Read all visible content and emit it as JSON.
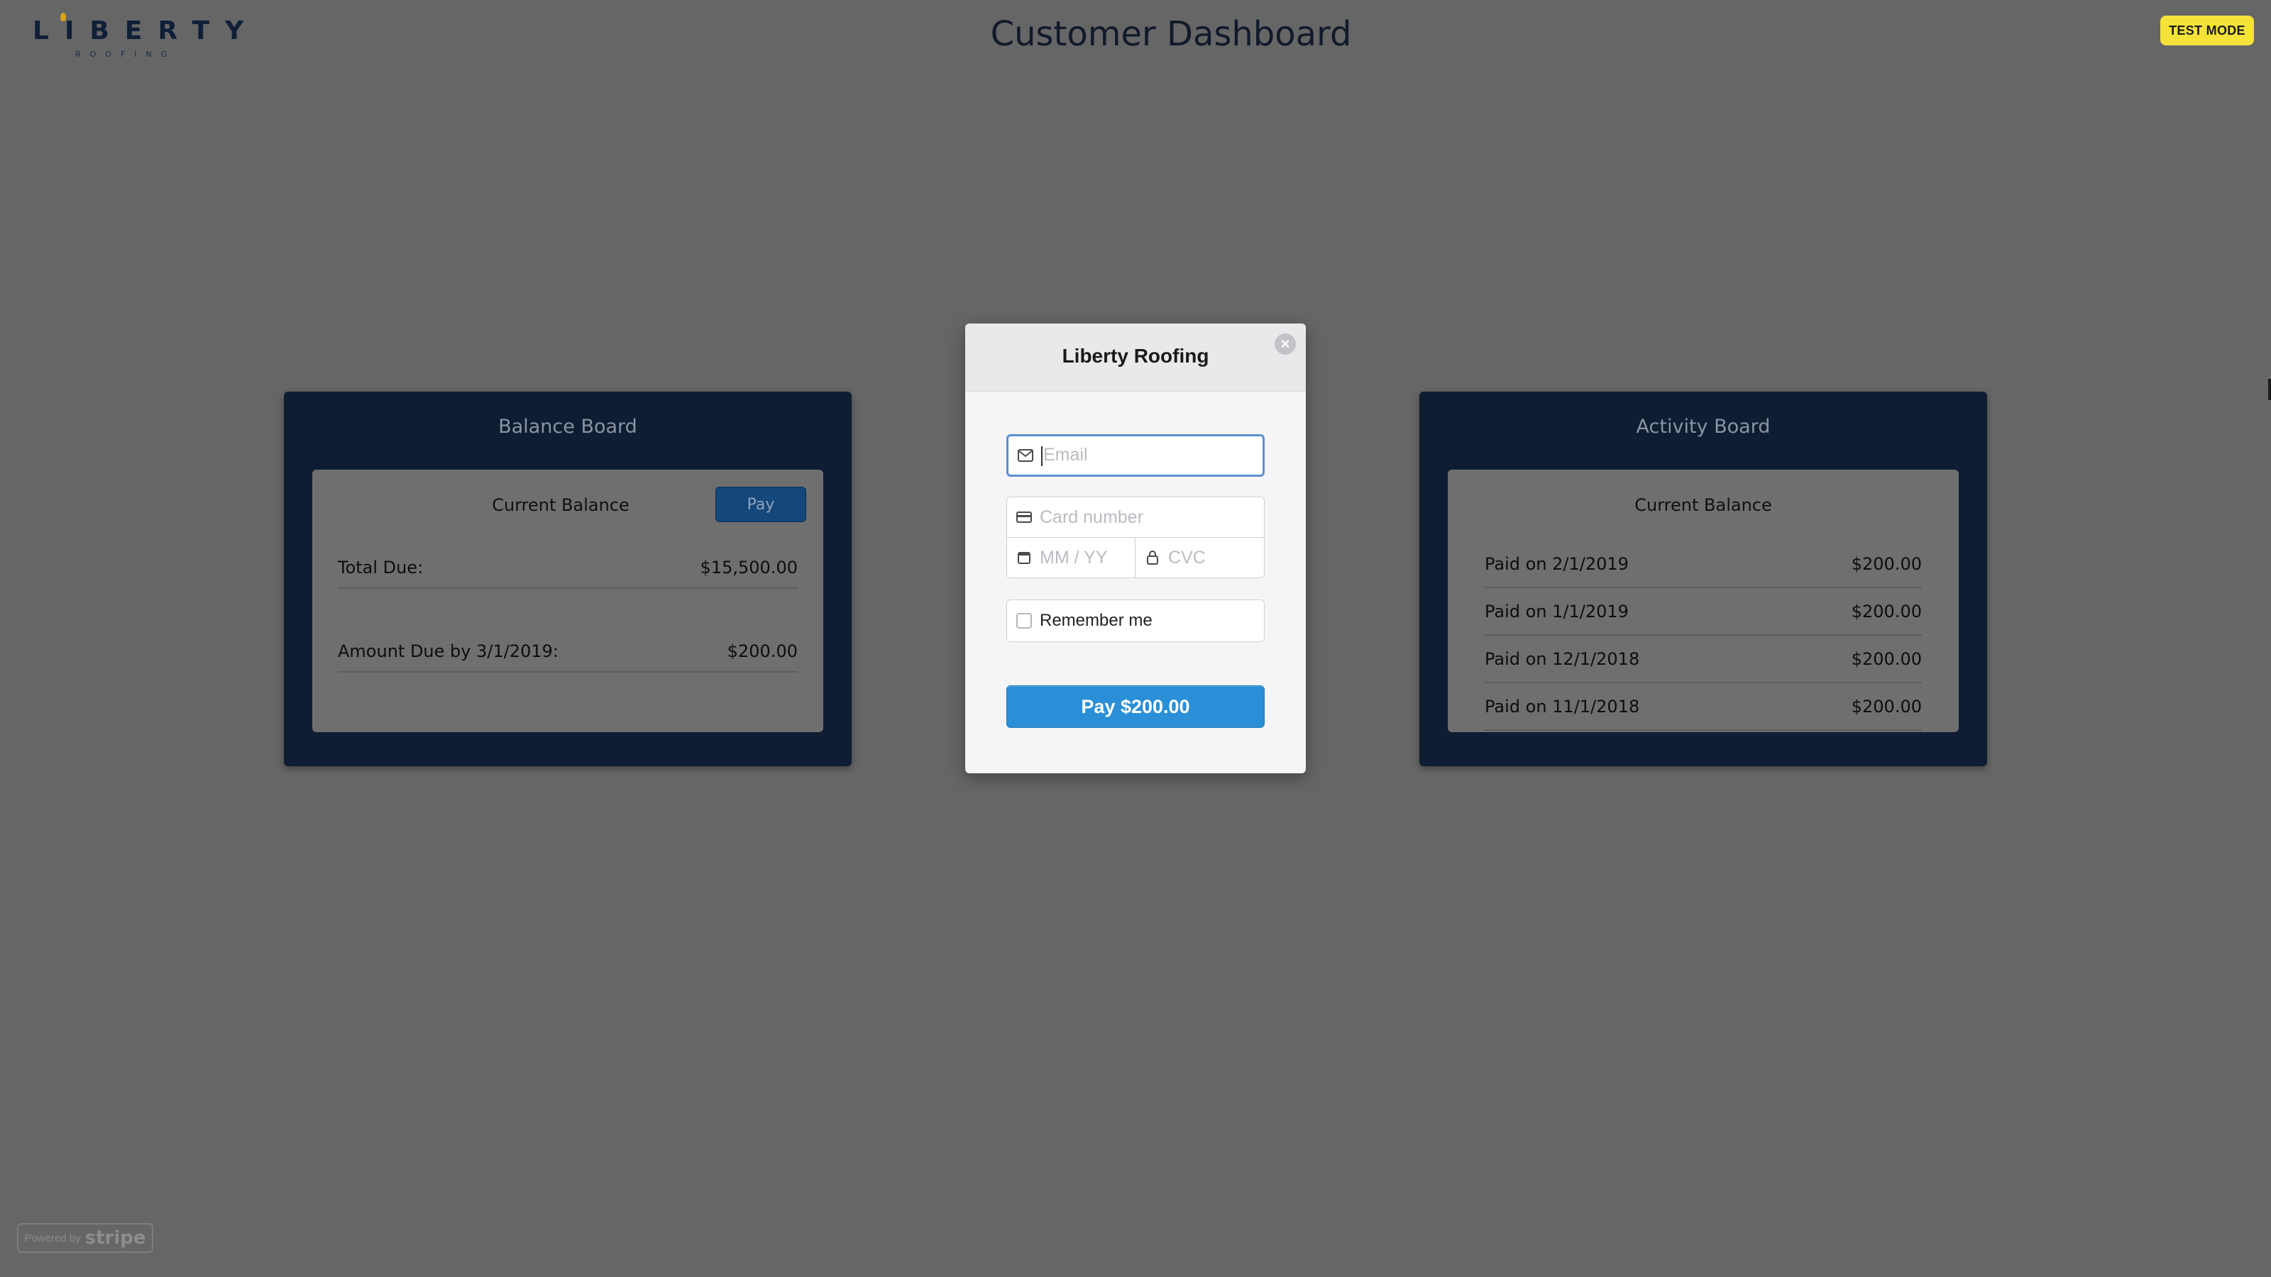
{
  "header": {
    "logo_word": "LIBERTY",
    "logo_sub": "ROOFING",
    "page_title": "Customer Dashboard",
    "badge": "TEST MODE"
  },
  "balance_board": {
    "title": "Balance Board",
    "inner_title": "Current Balance",
    "pay_label": "Pay",
    "rows": [
      {
        "label": "Total Due:",
        "value": "$15,500.00"
      },
      {
        "label": "Amount Due by 3/1/2019:",
        "value": "$200.00"
      }
    ]
  },
  "activity_board": {
    "title": "Activity Board",
    "inner_title": "Current Balance",
    "rows": [
      {
        "label": "Paid on 2/1/2019",
        "value": "$200.00"
      },
      {
        "label": "Paid on 1/1/2019",
        "value": "$200.00"
      },
      {
        "label": "Paid on 12/1/2018",
        "value": "$200.00"
      },
      {
        "label": "Paid on 11/1/2018",
        "value": "$200.00"
      }
    ]
  },
  "checkout": {
    "title": "Liberty Roofing",
    "close_glyph": "×",
    "email_placeholder": "Email",
    "card_placeholder": "Card number",
    "exp_placeholder": "MM / YY",
    "cvc_placeholder": "CVC",
    "remember_label": "Remember me",
    "pay_label": "Pay $200.00"
  },
  "footer": {
    "powered_small": "Powered by",
    "powered_brand": "stripe"
  },
  "colors": {
    "page_bg": "#666666",
    "board_bg": "#0f1d33",
    "badge_bg": "#f5e33a",
    "pay_button": "#2a8fd6"
  }
}
